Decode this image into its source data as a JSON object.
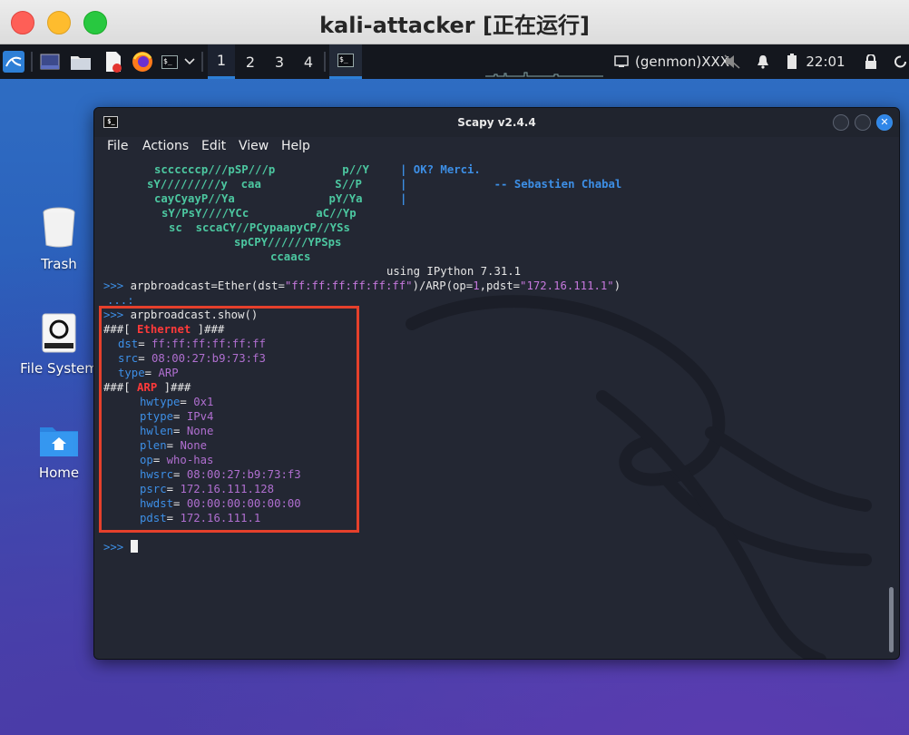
{
  "host": {
    "title": "kali-attacker [正在运行]"
  },
  "panel": {
    "workspaces": [
      "1",
      "2",
      "3",
      "4"
    ],
    "genmon": "(genmon)XXX",
    "clock": "22:01"
  },
  "desktop": {
    "icons": [
      {
        "label": "Trash"
      },
      {
        "label": "File System"
      },
      {
        "label": "Home"
      }
    ]
  },
  "terminal": {
    "title": "Scapy v2.4.4",
    "menu": [
      "File",
      "Actions",
      "Edit",
      "View",
      "Help"
    ],
    "banner": [
      "sccccccp///pSP///p          p//Y   ",
      "sY/////////y  caa           S//P   ",
      "cayCyayP//Ya              pY/Ya    ",
      "sY/PsY////YCc          aC//Yp     ",
      "sc  sccaCY//PCypaapyCP//YSs        ",
      "spCPY//////YPSps                    ",
      "ccaacs                               "
    ],
    "quote": [
      "| OK? Merci.",
      "|             -- Sebastien Chabal",
      "|"
    ],
    "ipython": "using IPython 7.31.1",
    "prompt": ">>>",
    "cont_prompt": "...:",
    "cmd1_prefix": "arpbroadcast=Ether(dst=",
    "cmd1_dst": "\"ff:ff:ff:ff:ff:ff\"",
    "cmd1_mid": ")/ARP(op=",
    "cmd1_op": "1",
    "cmd1_mid2": ",pdst=",
    "cmd1_pdst": "\"172.16.111.1\"",
    "cmd1_end": ")",
    "cmd2": "arpbroadcast.show()",
    "layers": [
      {
        "name": "Ethernet",
        "fields": [
          {
            "k": "dst",
            "v": "ff:ff:ff:ff:ff:ff"
          },
          {
            "k": "src",
            "v": "08:00:27:b9:73:f3"
          },
          {
            "k": "type",
            "v": "ARP"
          }
        ]
      },
      {
        "name": "ARP",
        "fields": [
          {
            "k": "hwtype",
            "v": "0x1"
          },
          {
            "k": "ptype",
            "v": "IPv4"
          },
          {
            "k": "hwlen",
            "v": "None"
          },
          {
            "k": "plen",
            "v": "None"
          },
          {
            "k": "op",
            "v": "who-has"
          },
          {
            "k": "hwsrc",
            "v": "08:00:27:b9:73:f3"
          },
          {
            "k": "psrc",
            "v": "172.16.111.128"
          },
          {
            "k": "hwdst",
            "v": "00:00:00:00:00:00"
          },
          {
            "k": "pdst",
            "v": "172.16.111.1"
          }
        ]
      }
    ],
    "colors": {
      "highlight": "#e5402b",
      "prompt": "#3d8fe6",
      "layer_name": "#ff3a3a",
      "value": "#b06fd0"
    }
  }
}
